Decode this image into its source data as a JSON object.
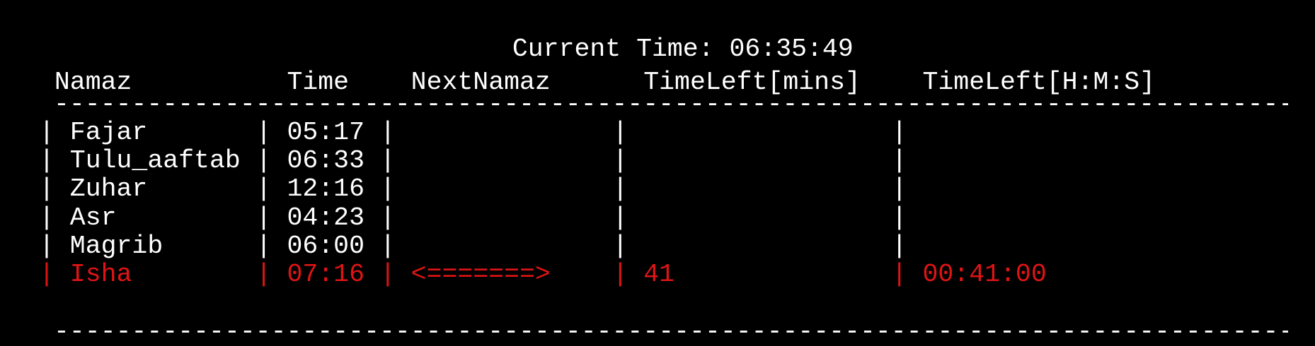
{
  "header": {
    "current_time_label": "Current Time:",
    "current_time_value": "06:35:49"
  },
  "columns": [
    "Namaz",
    "Time",
    "NextNamaz",
    "TimeLeft[mins]",
    "TimeLeft[H:M:S]"
  ],
  "separator": "--------------------------------------------------------------------------------------------",
  "rows": [
    {
      "namaz": "Fajar",
      "time": "05:17",
      "next": "",
      "mins": "",
      "hms": ""
    },
    {
      "namaz": "Tulu_aaftab",
      "time": "06:33",
      "next": "",
      "mins": "",
      "hms": ""
    },
    {
      "namaz": "Zuhar",
      "time": "12:16",
      "next": "",
      "mins": "",
      "hms": ""
    },
    {
      "namaz": "Asr",
      "time": "04:23",
      "next": "",
      "mins": "",
      "hms": ""
    },
    {
      "namaz": "Magrib",
      "time": "06:00",
      "next": "",
      "mins": "",
      "hms": ""
    },
    {
      "namaz": "Isha",
      "time": "07:16",
      "next": "<=======>",
      "mins": "41",
      "hms": "00:41:00"
    }
  ],
  "colors": {
    "background": "#000000",
    "text": "#ffffff",
    "highlight": "#e01414"
  }
}
